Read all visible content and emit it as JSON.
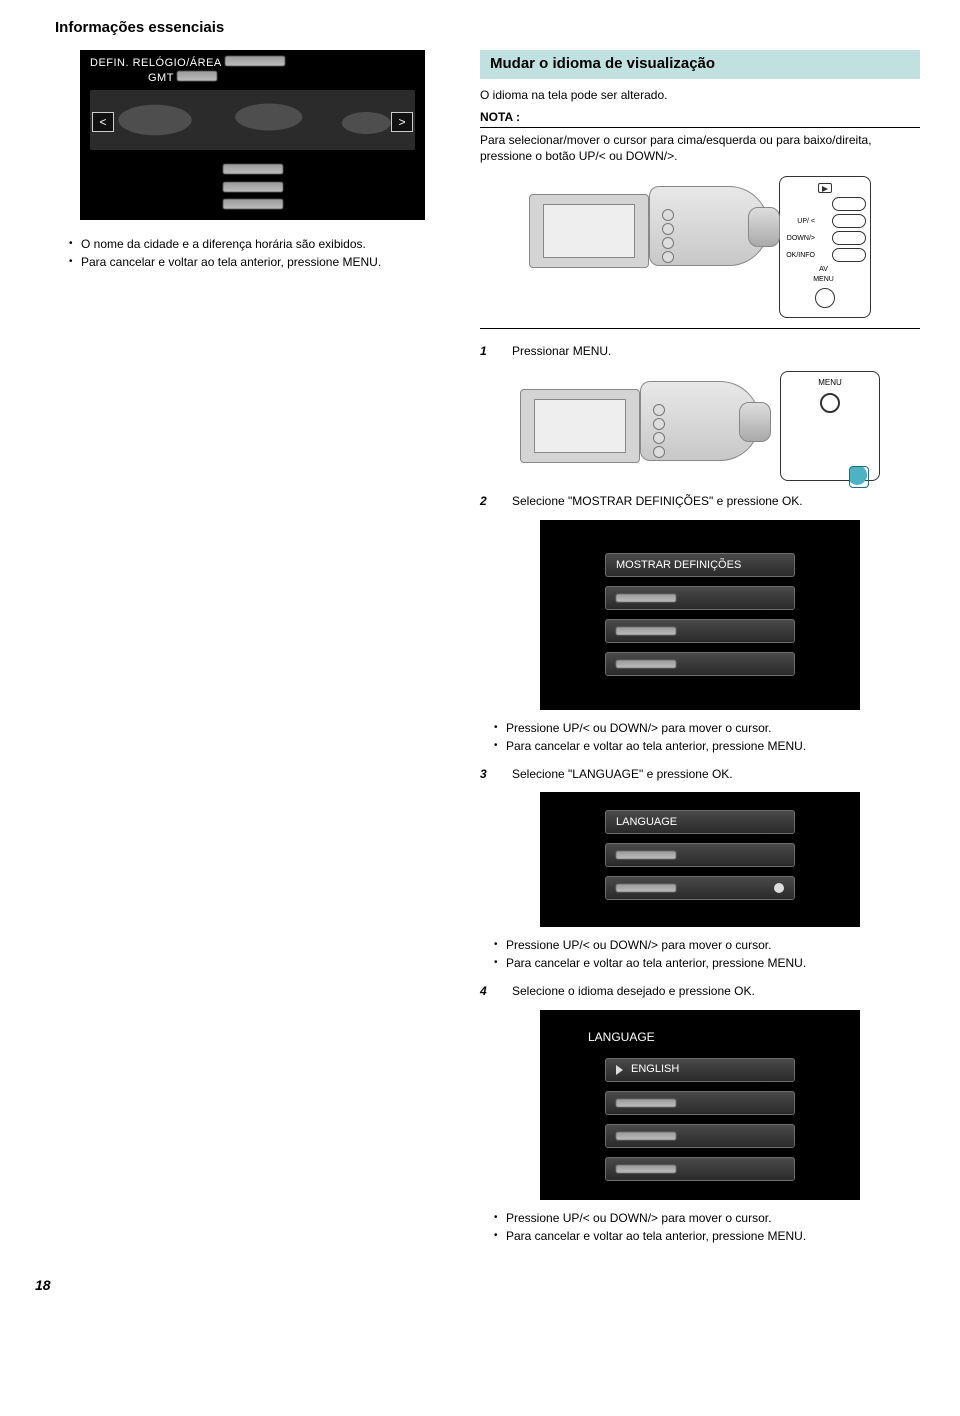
{
  "header": "Informações essenciais",
  "left": {
    "lcd_title": "DEFIN. RELÓGIO/ÁREA",
    "lcd_gmt": "GMT",
    "nav_left": "<",
    "nav_right": ">",
    "bullets": [
      "O nome da cidade e a diferença horária são exibidos.",
      "Para cancelar e voltar ao tela anterior, pressione MENU."
    ]
  },
  "right": {
    "section_title": "Mudar o idioma de visualização",
    "intro": "O idioma na tela pode ser alterado.",
    "nota_label": "NOTA :",
    "nota_text": "Para selecionar/mover o cursor para cima/esquerda ou para baixo/direita, pressione o botão UP/< ou DOWN/>.",
    "side_labels": {
      "up": "UP/ <",
      "down": "DOWN/>",
      "ok": "OK/INFO",
      "av": "AV",
      "menu": "MENU"
    },
    "steps": {
      "s1": "Pressionar MENU.",
      "menu_label": "MENU",
      "s2": "Selecione \"MOSTRAR DEFINIÇÕES\" e pressione OK.",
      "menu2_item": "MOSTRAR DEFINIÇÕES",
      "sub_a": "Pressione UP/< ou DOWN/> para mover o cursor.",
      "sub_b": "Para cancelar e voltar ao tela anterior, pressione MENU.",
      "s3": "Selecione \"LANGUAGE\" e pressione OK.",
      "menu3_item": "LANGUAGE",
      "s4": "Selecione o idioma desejado e pressione OK.",
      "menu4_title": "LANGUAGE",
      "menu4_item": "ENGLISH"
    }
  },
  "page_number": "18"
}
